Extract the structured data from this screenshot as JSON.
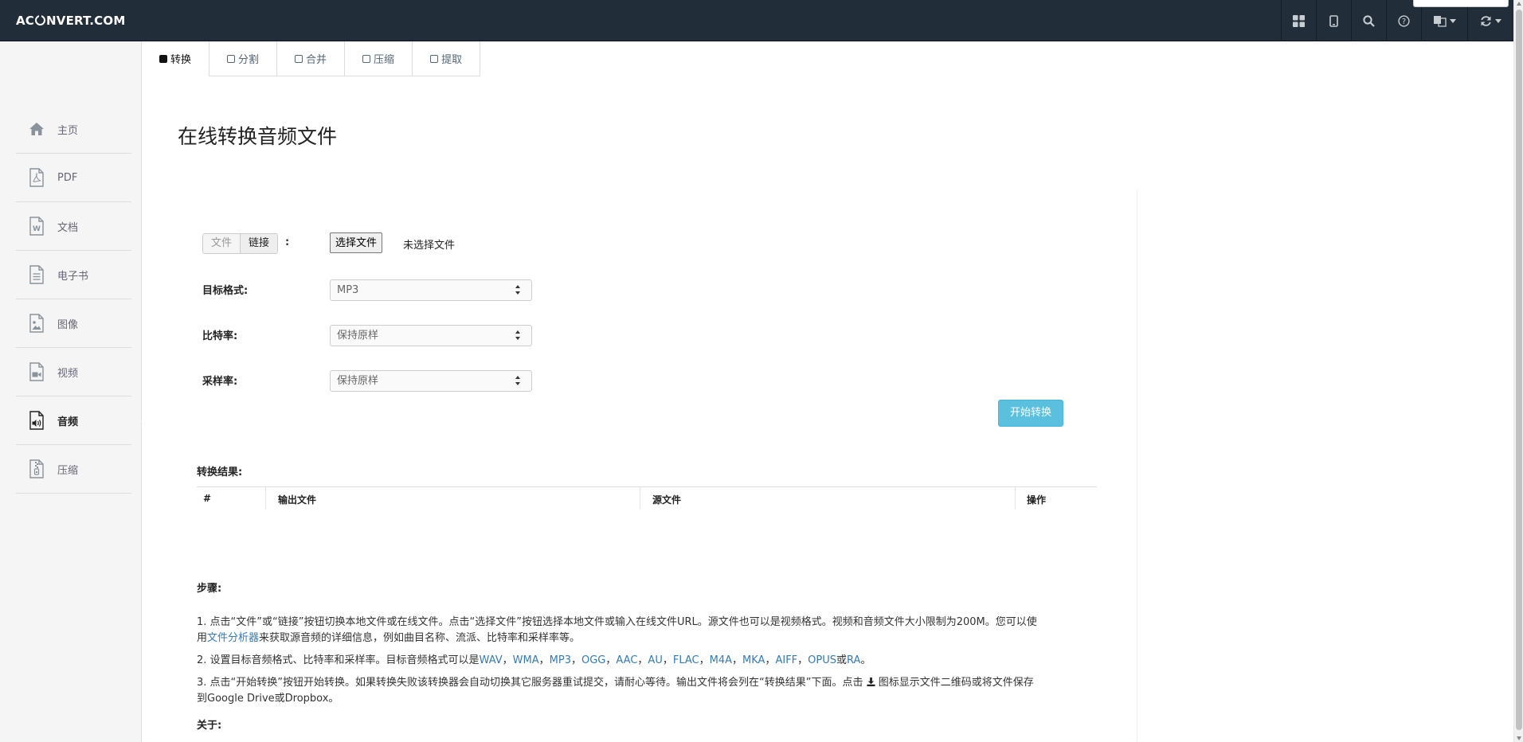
{
  "navbar": {
    "brand_left": "AC",
    "brand_right": "NVERT.COM",
    "icons": [
      "grid-icon",
      "tablet-icon",
      "search-icon",
      "help-icon",
      "language-icon",
      "sync-icon"
    ]
  },
  "tabs": [
    {
      "label": "转换",
      "active": true
    },
    {
      "label": "分割",
      "active": false
    },
    {
      "label": "合并",
      "active": false
    },
    {
      "label": "压缩",
      "active": false
    },
    {
      "label": "提取",
      "active": false
    }
  ],
  "sidebar": {
    "items": [
      {
        "label": "主页",
        "icon": "home-icon"
      },
      {
        "label": "PDF",
        "icon": "pdf-file-icon"
      },
      {
        "label": "文档",
        "icon": "word-file-icon"
      },
      {
        "label": "电子书",
        "icon": "ebook-file-icon"
      },
      {
        "label": "图像",
        "icon": "image-file-icon"
      },
      {
        "label": "视频",
        "icon": "video-file-icon"
      },
      {
        "label": "音频",
        "icon": "audio-file-icon",
        "active": true
      },
      {
        "label": "压缩",
        "icon": "archive-file-icon"
      }
    ]
  },
  "page": {
    "title": "在线转换音频文件"
  },
  "form": {
    "source_toggle": {
      "file": "文件",
      "link": "链接",
      "colon": ":"
    },
    "choose_file_button": "选择文件",
    "no_file_text": "未选择文件",
    "target_format_label": "目标格式:",
    "target_format_value": "MP3",
    "bitrate_label": "比特率:",
    "bitrate_value": "保持原样",
    "samplerate_label": "采样率:",
    "samplerate_value": "保持原样",
    "start_button": "开始转换"
  },
  "results": {
    "label": "转换结果:",
    "columns": [
      "#",
      "输出文件",
      "源文件",
      "操作"
    ]
  },
  "steps": {
    "heading": "步骤:",
    "step1_a": "1. 点击“文件”或“链接”按钮切换本地文件或在线文件。点击“选择文件”按钮选择本地文件或输入在线文件URL。源文件也可以是视频格式。视频和音频文件大小限制为200M。您可以使",
    "step1_b": "用",
    "step1_link": "文件分析器",
    "step1_c": "来获取源音频的详细信息，例如曲目名称、流派、比特率和采样率等。",
    "step2_a": "2. 设置目标音频格式、比特率和采样率。目标音频格式可以是",
    "formats": [
      "WAV",
      "WMA",
      "MP3",
      "OGG",
      "AAC",
      "AU",
      "FLAC",
      "M4A",
      "MKA",
      "AIFF",
      "OPUS"
    ],
    "sep": "，",
    "or": "或",
    "last_format": "RA",
    "end": "。",
    "step3_a": "3. 点击“开始转换”按钮开始转换。如果转换失败该转换器会自动切换其它服务器重试提交，请耐心等待。输出文件将会列在“转换结果”下面。点击",
    "step3_b": "图标显示文件二维码或将文件保存",
    "step3_c": "到Google Drive或Dropbox。",
    "about": "关于:"
  }
}
